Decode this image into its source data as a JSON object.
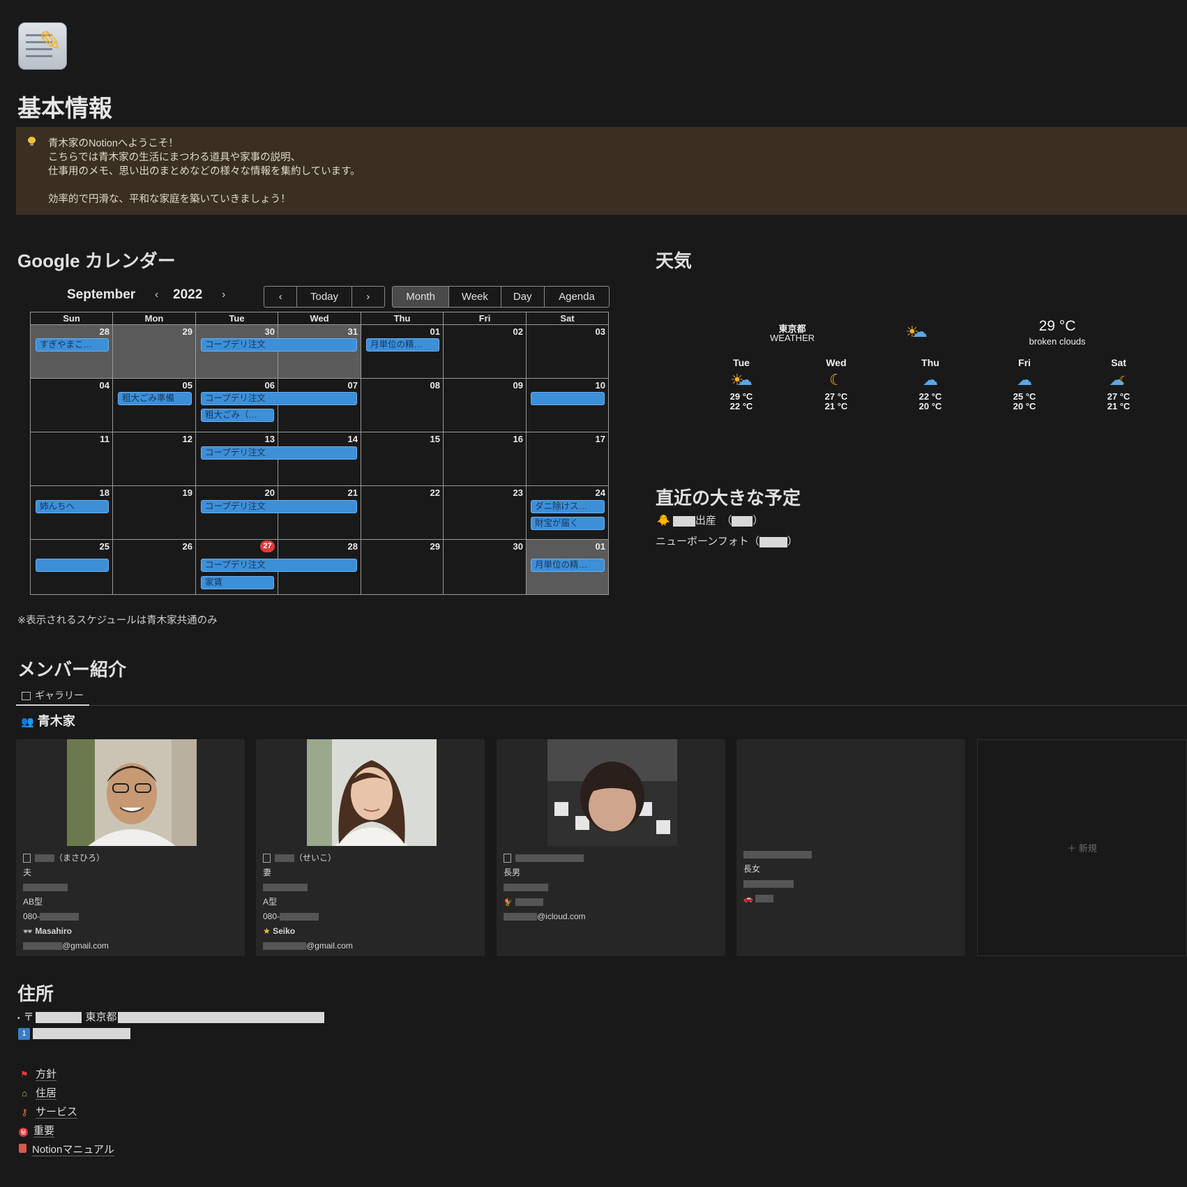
{
  "page": {
    "title": "基本情報"
  },
  "callout": {
    "line1": "青木家のNotionへようこそ！",
    "line2": "こちらでは青木家の生活にまつわる道具や家事の説明、",
    "line3": "仕事用のメモ、思い出のまとめなどの様々な情報を集約しています。",
    "line4": "効率的で円滑な、平和な家庭を築いていきましょう！"
  },
  "calendar": {
    "heading": "Google カレンダー",
    "month": "September",
    "year": "2022",
    "prev_year": "‹",
    "next_year": "›",
    "nav": {
      "prev": "‹",
      "today": "Today",
      "next": "›"
    },
    "views": [
      "Month",
      "Week",
      "Day",
      "Agenda"
    ],
    "active_view": "Month",
    "weekdays": [
      "Sun",
      "Mon",
      "Tue",
      "Wed",
      "Thu",
      "Fri",
      "Sat"
    ],
    "weeks": [
      [
        "28",
        "29",
        "30",
        "31",
        "01",
        "02",
        "03"
      ],
      [
        "04",
        "05",
        "06",
        "07",
        "08",
        "09",
        "10"
      ],
      [
        "11",
        "12",
        "13",
        "14",
        "15",
        "16",
        "17"
      ],
      [
        "18",
        "19",
        "20",
        "21",
        "22",
        "23",
        "24"
      ],
      [
        "25",
        "26",
        "27",
        "28",
        "29",
        "30",
        "01"
      ]
    ],
    "events": {
      "w0_sun": "すぎやまこ…",
      "w0_tue": "コープデリ注文",
      "w0_thu": "月単位の精…",
      "w1_mon": "粗大ごみ準備",
      "w1_tue": "コープデリ注文",
      "w1_tue2": "粗大ごみ（…",
      "w1_sat": "",
      "w2_tue": "コープデリ注文",
      "w3_sun": "姉んちへ",
      "w3_tue": "コープデリ注文",
      "w3_sat": "ダニ除けス…",
      "w3_sat2": "財宝が届く",
      "w4_sun": "",
      "w4_tue": "コープデリ注文",
      "w4_tue2": "家賃",
      "w4_sat": "月単位の精…"
    },
    "note": "※表示されるスケジュールは青木家共通のみ"
  },
  "weather": {
    "heading": "天気",
    "city": "東京都",
    "label": "WEATHER",
    "current_temp": "29 °C",
    "description": "broken clouds",
    "forecast": [
      {
        "day": "Tue",
        "icon": "sun-cloud-icon",
        "hi": "29 °C",
        "lo": "22 °C"
      },
      {
        "day": "Wed",
        "icon": "moon-icon",
        "hi": "27 °C",
        "lo": "21 °C"
      },
      {
        "day": "Thu",
        "icon": "cloud-icon",
        "hi": "22 °C",
        "lo": "20 °C"
      },
      {
        "day": "Fri",
        "icon": "cloud-icon",
        "hi": "25 °C",
        "lo": "20 °C"
      },
      {
        "day": "Sat",
        "icon": "moon-cloud-icon",
        "hi": "27 °C",
        "lo": "21 °C"
      }
    ]
  },
  "upcoming": {
    "heading": "直近の大きな予定",
    "item1_text": "出産　（",
    "item1_close": "）",
    "item2_text": "ニューボーンフォト（",
    "item2_close": "）"
  },
  "members": {
    "heading": "メンバー紹介",
    "tab": "ギャラリー",
    "group": "青木家",
    "cards": [
      {
        "name_suffix": "（まさひろ）",
        "role": "夫",
        "blood": "AB型",
        "phone_prefix": "080-",
        "nickname": "Masahiro",
        "email_suffix": "@gmail.com"
      },
      {
        "name_suffix": "（せいこ）",
        "role": "妻",
        "blood": "A型",
        "phone_prefix": "080-",
        "nickname": "Seiko",
        "email_suffix": "@gmail.com"
      },
      {
        "name_suffix": "",
        "role": "長男",
        "email_suffix": "@icloud.com"
      },
      {
        "name_suffix": "",
        "role": "長女"
      }
    ],
    "new_label": "＋ 新規"
  },
  "address": {
    "heading": "住所",
    "postal_mark": "〒",
    "prefecture": "東京都"
  },
  "links": [
    "方針",
    "住居",
    "サービス",
    "重要",
    "Notionマニュアル"
  ]
}
